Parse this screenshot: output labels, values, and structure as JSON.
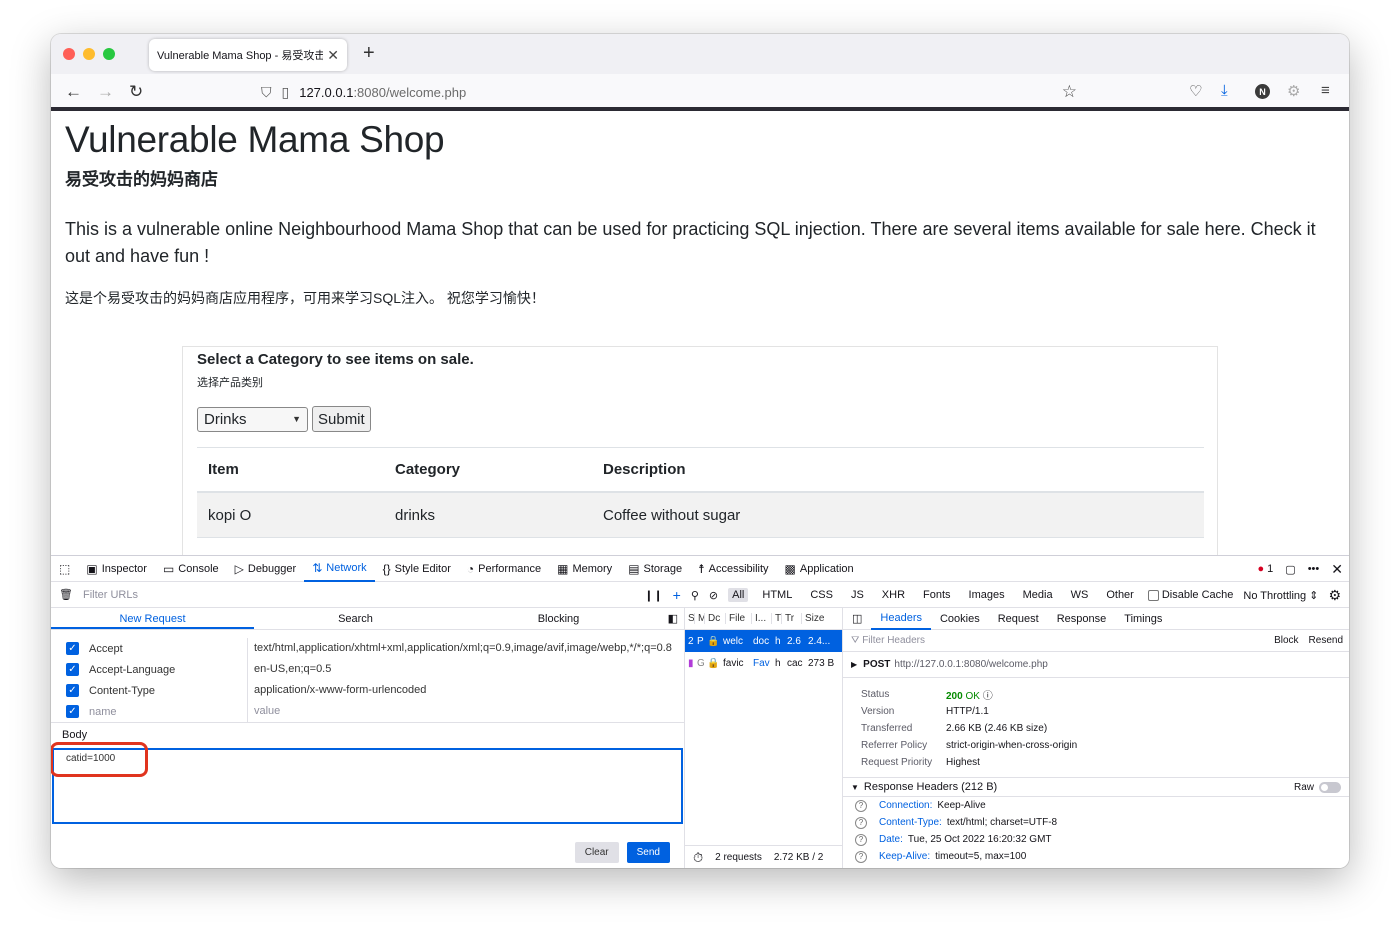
{
  "browser": {
    "tab_title": "Vulnerable Mama Shop - 易受攻击的妈妈",
    "url_host": "127.0.0.1",
    "url_path": ":8080/welcome.php"
  },
  "page": {
    "title": "Vulnerable Mama Shop",
    "subtitle": "易受攻击的妈妈商店",
    "lead": "This is a vulnerable online Neighbourhood Mama Shop that can be used for practicing SQL injection. There are several items available for sale here. Check it out and have fun !",
    "lead_cn": "这是个易受攻击的妈妈商店应用程序，可用来学习SQL注入。 祝您学习愉快！",
    "card_heading": "Select a Category to see items on sale.",
    "card_sub": "选择产品类别",
    "selected_category": "Drinks",
    "submit_label": "Submit",
    "table_headers": [
      "Item",
      "Category",
      "Description"
    ],
    "rows": [
      {
        "item": "kopi O",
        "category": "drinks",
        "description": "Coffee without sugar"
      }
    ]
  },
  "devtools": {
    "tools": [
      "Inspector",
      "Console",
      "Debugger",
      "Network",
      "Style Editor",
      "Performance",
      "Memory",
      "Storage",
      "Accessibility",
      "Application"
    ],
    "error_count": "1",
    "filter_placeholder": "Filter URLs",
    "filter_types": [
      "All",
      "HTML",
      "CSS",
      "JS",
      "XHR",
      "Fonts",
      "Images",
      "Media",
      "WS",
      "Other"
    ],
    "disable_cache": "Disable Cache",
    "throttling": "No Throttling ⇕",
    "left_tabs": [
      "New Request",
      "Search",
      "Blocking"
    ],
    "headers": [
      {
        "name": "Accept",
        "value": "text/html,application/xhtml+xml,application/xml;q=0.9,image/avif,image/webp,*/*;q=0.8"
      },
      {
        "name": "Accept-Language",
        "value": "en-US,en;q=0.5"
      },
      {
        "name": "Content-Type",
        "value": "application/x-www-form-urlencoded"
      }
    ],
    "new_header_name": "name",
    "new_header_value": "value",
    "body_label": "Body",
    "body_value": "catid=1000",
    "clear_label": "Clear",
    "send_label": "Send",
    "requests": [
      {
        "status": "2",
        "method": "P",
        "file": "welc",
        "init": "doc",
        "type": "h",
        "transferred": "2.6",
        "size": "2.4..."
      },
      {
        "status": "",
        "method": "G",
        "file": "favic",
        "init": "Fav",
        "type": "h",
        "transferred": "cac",
        "size": "273 B"
      }
    ],
    "req_cols": [
      "S",
      "M",
      "Dc",
      "File",
      "I...",
      "T",
      "Tr",
      "Size"
    ],
    "footer_requests": "2 requests",
    "footer_size": "2.72 KB / 2",
    "right_tabs": [
      "Headers",
      "Cookies",
      "Request",
      "Response",
      "Timings"
    ],
    "filter_headers": "Filter Headers",
    "block_label": "Block",
    "resend_label": "Resend",
    "method": "POST",
    "req_url": "http://127.0.0.1:8080/welcome.php",
    "summary": [
      {
        "k": "Status",
        "v": ""
      },
      {
        "k": "Version",
        "v": "HTTP/1.1"
      },
      {
        "k": "Transferred",
        "v": "2.66 KB (2.46 KB size)"
      },
      {
        "k": "Referrer Policy",
        "v": "strict-origin-when-cross-origin"
      },
      {
        "k": "Request Priority",
        "v": "Highest"
      }
    ],
    "status_code": "200",
    "status_text": "OK",
    "resp_headers_title": "Response Headers (212 B)",
    "raw_label": "Raw",
    "resp_headers": [
      {
        "n": "Connection:",
        "v": "Keep-Alive"
      },
      {
        "n": "Content-Type:",
        "v": "text/html; charset=UTF-8"
      },
      {
        "n": "Date:",
        "v": "Tue, 25 Oct 2022 16:20:32 GMT"
      },
      {
        "n": "Keep-Alive:",
        "v": "timeout=5, max=100"
      }
    ]
  }
}
